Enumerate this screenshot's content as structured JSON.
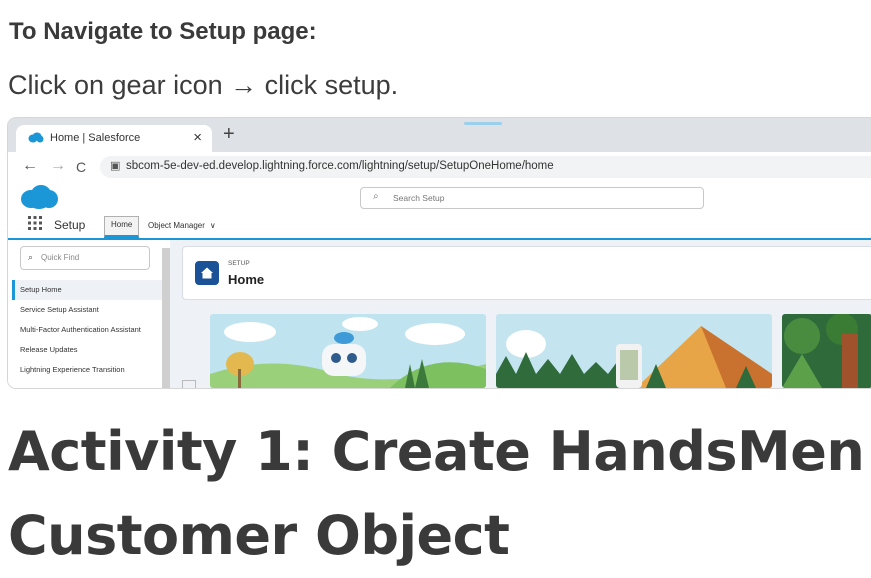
{
  "section": {
    "heading": "To Navigate to Setup page:",
    "instruction": "Click on gear icon → click setup."
  },
  "screenshot": {
    "browser": {
      "tab_title": "Home | Salesforce",
      "tab_close": "×",
      "new_tab": "+",
      "back": "←",
      "forward": "→",
      "reload": "C",
      "url": "sbcom-5e-dev-ed.develop.lightning.force.com/lightning/setup/SetupOneHome/home"
    },
    "salesforce": {
      "search_placeholder": "Search Setup",
      "app_name": "Setup",
      "nav_tabs": [
        "Home",
        "Object Manager"
      ],
      "quick_find_placeholder": "Quick Find",
      "menu_items": [
        "Setup Home",
        "Service Setup Assistant",
        "Multi-Factor Authentication Assistant",
        "Release Updates",
        "Lightning Experience Transition"
      ],
      "page_eyebrow": "SETUP",
      "page_title": "Home"
    },
    "colors": {
      "salesforce_blue": "#1b96d6",
      "home_icon": "#1b5297",
      "browser_chrome": "#dee1e6"
    }
  },
  "activity": {
    "heading": "Activity 1: Create HandsMen Customer Object"
  }
}
